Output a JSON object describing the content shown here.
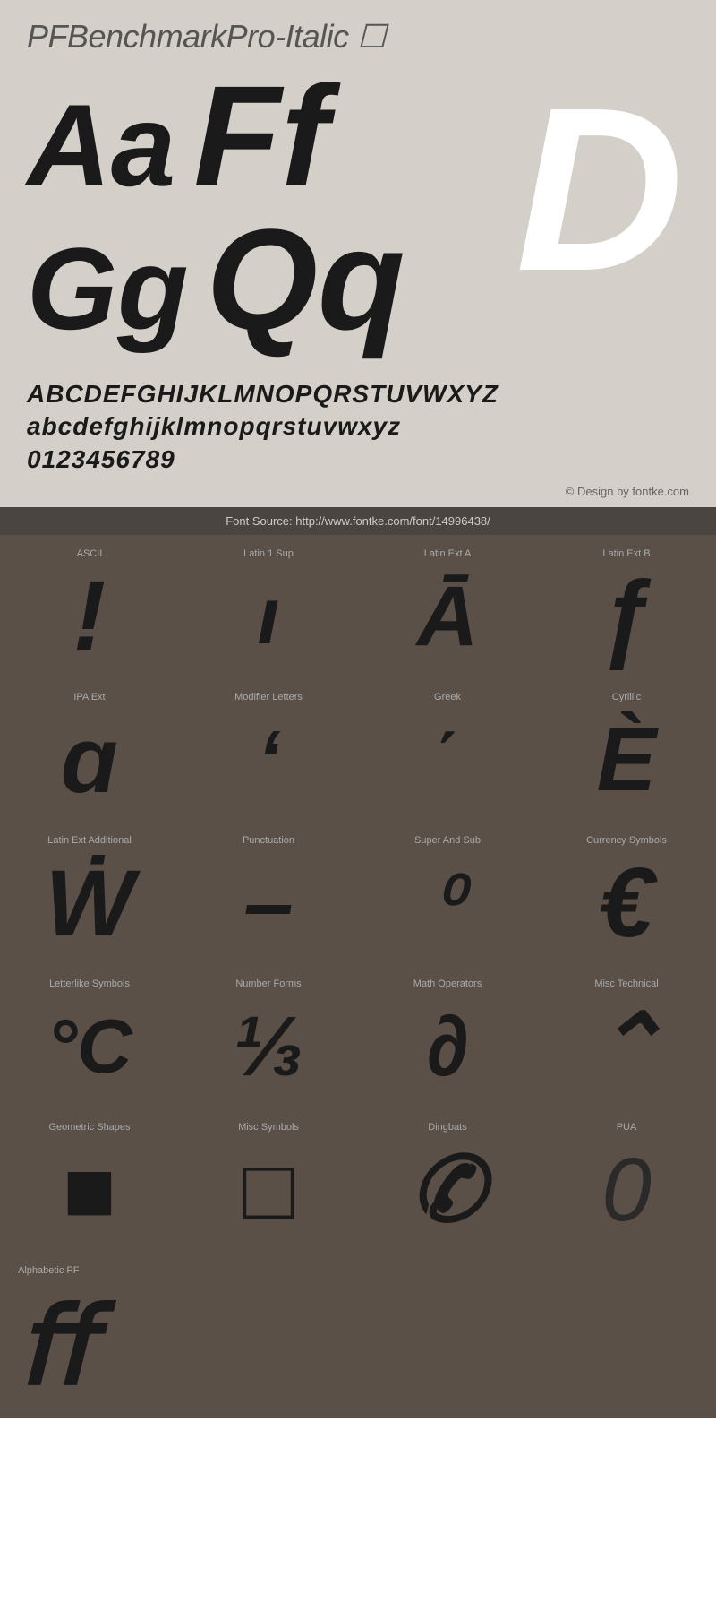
{
  "title": "PFBenchmarkPro-Italic ☐",
  "preview": {
    "letters": [
      {
        "pair": "Aa",
        "pair2": "Ff"
      },
      {
        "pair": "Gg",
        "pair2": "Qq"
      }
    ],
    "bigLetter": "D"
  },
  "alphabet": {
    "upper": "ABCDEFGHIJKLMNOPQRSTUVWXYZ",
    "lower": "abcdefghijklmnopqrstuvwxyz",
    "digits": "0123456789"
  },
  "credit": "© Design by fontke.com",
  "source": "Font Source: http://www.fontke.com/font/14996438/",
  "glyphs": [
    {
      "label": "ASCII",
      "char": "!",
      "size": "large"
    },
    {
      "label": "Latin 1 Sup",
      "char": "ı",
      "size": "large"
    },
    {
      "label": "Latin Ext A",
      "char": "Ā",
      "size": "large"
    },
    {
      "label": "Latin Ext B",
      "char": "ƒ",
      "size": "large"
    },
    {
      "label": "IPA Ext",
      "char": "ɑ",
      "size": "large"
    },
    {
      "label": "Modifier Letters",
      "char": "ʻ",
      "size": "large"
    },
    {
      "label": "Greek",
      "char": "΄",
      "size": "large"
    },
    {
      "label": "Cyrillic",
      "char": "È",
      "size": "large"
    },
    {
      "label": "Latin Ext Additional",
      "char": "Ẇ",
      "size": "large"
    },
    {
      "label": "Punctuation",
      "char": "–",
      "size": "large"
    },
    {
      "label": "Super And Sub",
      "char": "⁰",
      "size": "large"
    },
    {
      "label": "Currency Symbols",
      "char": "€",
      "size": "large"
    },
    {
      "label": "Letterlike Symbols",
      "char": "°C",
      "size": "medium"
    },
    {
      "label": "Number Forms",
      "char": "⅓",
      "size": "large"
    },
    {
      "label": "Math Operators",
      "char": "∂",
      "size": "large"
    },
    {
      "label": "Misc Technical",
      "char": "⌃",
      "size": "large"
    },
    {
      "label": "Geometric Shapes",
      "char": "■",
      "size": "large"
    },
    {
      "label": "Misc Symbols",
      "char": "□",
      "size": "large"
    },
    {
      "label": "Dingbats",
      "char": "✆",
      "size": "large"
    },
    {
      "label": "PUA",
      "char": "0",
      "size": "large"
    }
  ],
  "bottom": {
    "label": "Alphabetic PF",
    "char": "ﬀ"
  }
}
